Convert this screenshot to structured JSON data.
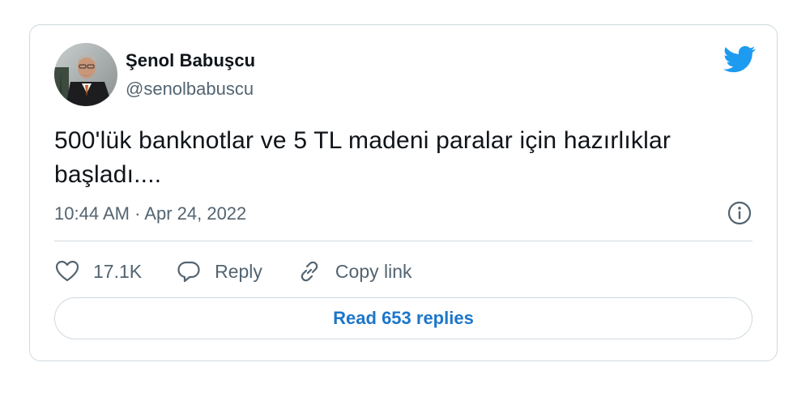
{
  "author": {
    "name": "Şenol Babuşcu",
    "handle": "@senolbabuscu"
  },
  "tweet": {
    "text": "500'lük banknotlar ve 5 TL madeni paralar için hazırlıklar başladı....",
    "timestamp": "10:44 AM · Apr 24, 2022"
  },
  "actions": {
    "like_count": "17.1K",
    "reply_label": "Reply",
    "copy_link_label": "Copy link"
  },
  "read_replies_label": "Read 653 replies",
  "icons": {
    "brand": "twitter-bird-icon",
    "info": "info-icon",
    "like": "heart-icon",
    "reply": "speech-bubble-icon",
    "copy": "link-icon"
  },
  "colors": {
    "brand": "#1d9bf0",
    "link_text": "#1d76c9",
    "muted_text": "#536471",
    "border": "#cfd9de"
  }
}
